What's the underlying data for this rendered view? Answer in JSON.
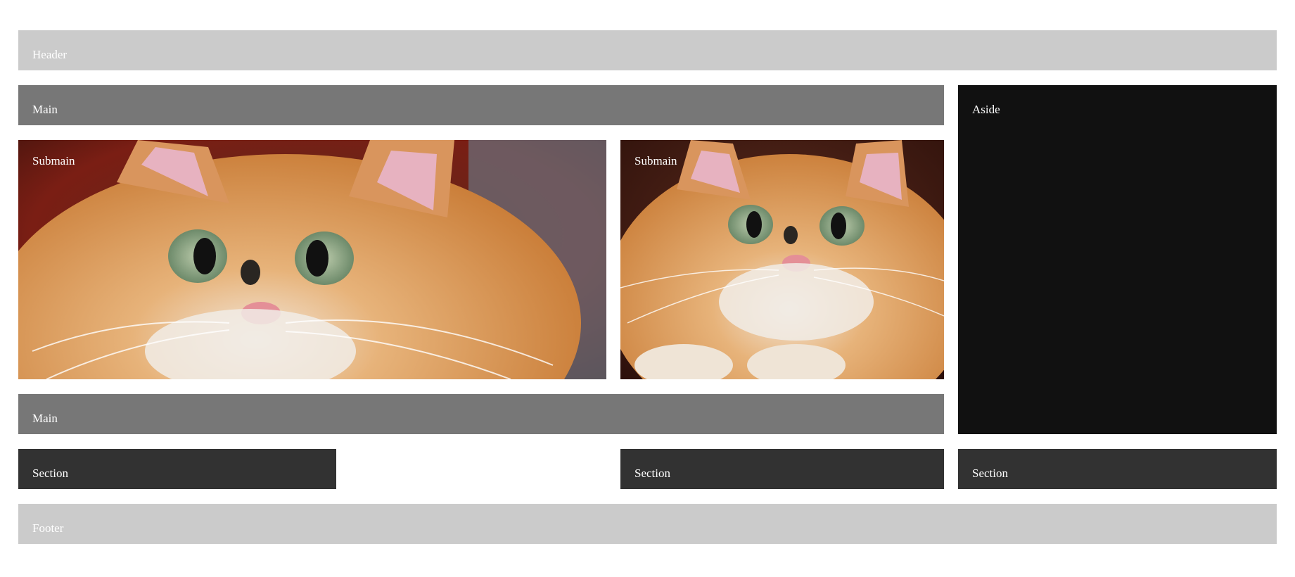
{
  "header": {
    "label": "Header"
  },
  "main_top": {
    "label": "Main"
  },
  "aside": {
    "label": "Aside"
  },
  "submain_left": {
    "label": "Submain"
  },
  "submain_right": {
    "label": "Submain"
  },
  "main_bottom": {
    "label": "Main"
  },
  "sections": [
    {
      "label": "Section"
    },
    {
      "label": "Section"
    },
    {
      "label": "Section"
    }
  ],
  "footer": {
    "label": "Footer"
  },
  "colors": {
    "header_footer": "#cbcbcb",
    "main": "#777777",
    "aside": "#111111",
    "section": "#323232",
    "text": "#ffffff"
  }
}
